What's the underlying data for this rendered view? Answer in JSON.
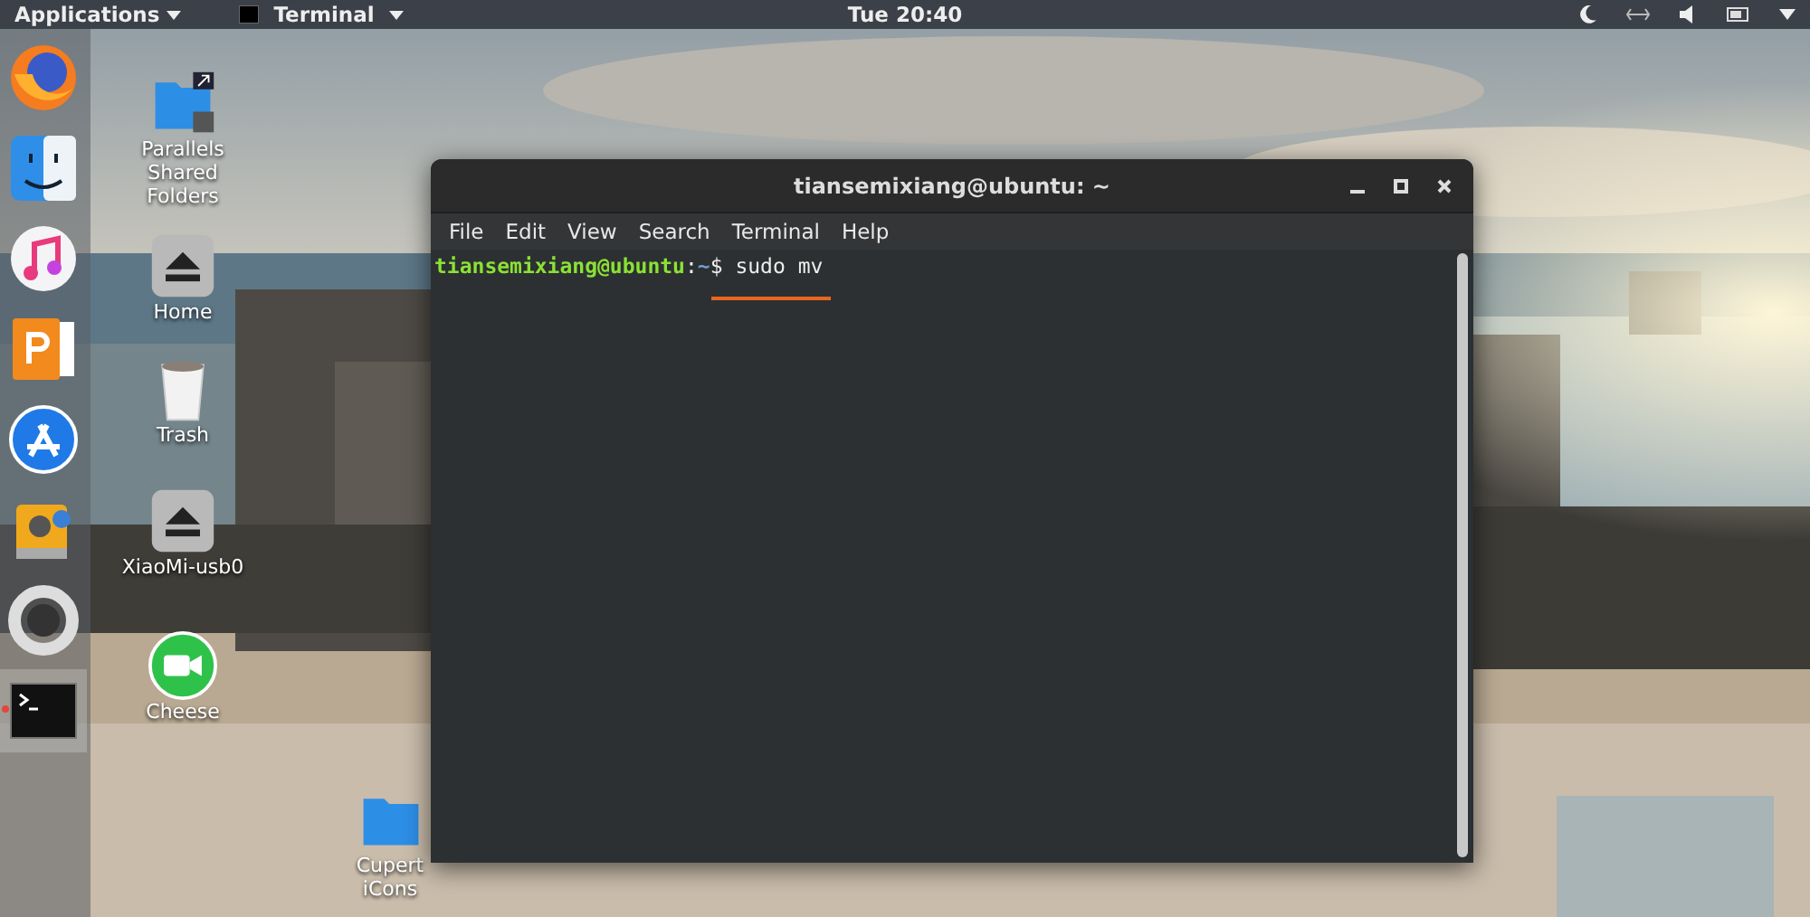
{
  "top_bar": {
    "applications_menu": "Applications",
    "app_menu": "Terminal",
    "clock": "Tue 20:40"
  },
  "dock": [
    {
      "selected": false
    },
    {
      "selected": false
    },
    {
      "selected": false
    },
    {
      "selected": false
    },
    {
      "selected": false
    },
    {
      "selected": false
    },
    {
      "selected": false
    },
    {
      "selected": true
    }
  ],
  "desktop_icons": [
    {
      "kind": "shared-folder",
      "label": "Parallels Shared Folders"
    },
    {
      "kind": "drive",
      "label": "Home"
    },
    {
      "kind": "trash",
      "label": "Trash"
    },
    {
      "kind": "drive",
      "label": "XiaoMi-usb0"
    },
    {
      "kind": "camera",
      "label": "Cheese"
    },
    {
      "kind": "folder",
      "label": "Cupert iCons"
    }
  ],
  "terminal": {
    "title": "tiansemixiang@ubuntu: ~",
    "menu": [
      "File",
      "Edit",
      "View",
      "Search",
      "Terminal",
      "Help"
    ],
    "prompt": {
      "user": "tiansemixiang@ubuntu",
      "separator": ":",
      "path": "~",
      "symbol": "$",
      "command": "sudo mv"
    }
  }
}
